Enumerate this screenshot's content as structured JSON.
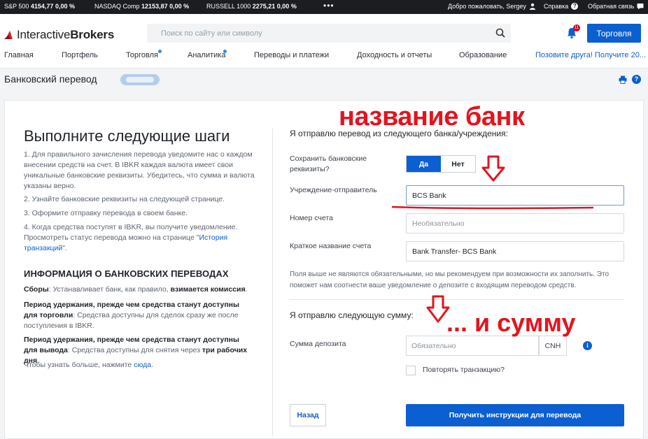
{
  "ticker": {
    "items": [
      {
        "name": "S&P 500",
        "value": "4154,77",
        "change": "0,00 %"
      },
      {
        "name": "NASDAQ Comp",
        "value": "12153,87",
        "change": "0,00 %"
      },
      {
        "name": "RUSSELL 1000",
        "value": "2275,21",
        "change": "0,00 %"
      }
    ],
    "more": "•••",
    "welcome": "Добро пожаловать, Sergey",
    "help": "Справка",
    "feedback": "Обратная связь"
  },
  "header": {
    "logo_light": "Interactive",
    "logo_bold": "Brokers",
    "search_placeholder": "Поиск по сайту или символу",
    "notification_count": "11",
    "trade_button": "Торговля"
  },
  "nav": {
    "items": [
      "Главная",
      "Портфель",
      "Торговля",
      "Аналитика",
      "Переводы и платежи",
      "Доходность и отчеты",
      "Образование"
    ],
    "invite": "Позовите друга! Получите 20..."
  },
  "page": {
    "title": "Банковский перевод"
  },
  "left": {
    "title": "Выполните следующие шаги",
    "step1": "1. Для правильного зачисления перевода уведомите нас о каждом внесении средств на счет. В IBKR каждая валюта имеет свои уникальные банковские реквизиты. Убедитесь, что сумма и валюта указаны верно.",
    "step2": "2. Узнайте банковские реквизиты на следующей странице.",
    "step3": "3. Оформите отправку перевода в своем банке.",
    "step4_text": "4. Когда средства поступят в IBKR, вы получите уведомление. Просмотреть статус перевода можно на странице \"",
    "step4_link": "История транзакций",
    "step4_end": "\".",
    "info_title": "ИНФОРМАЦИЯ О БАНКОВСКИХ ПЕРЕВОДАХ",
    "fees_label": "Сборы",
    "fees_text": ": Устанавливает банк, как правило, ",
    "fees_bold": "взимается комиссия",
    "fees_end": ".",
    "hold_trade_label": "Период удержания, прежде чем средства станут доступны для торговли",
    "hold_trade_text": ": Средства доступны для сделок сразу же после поступления в IBKR.",
    "hold_withdraw_label": "Период удержания, прежде чем средства станут доступны для вывода",
    "hold_withdraw_text": ": Средства доступны для снятия через ",
    "hold_withdraw_bold": "три рабочих дня",
    "hold_withdraw_end": ".",
    "more_text": "Чтобы узнать больше, нажмите ",
    "more_link": "сюда",
    "more_end": "."
  },
  "right": {
    "section1_title": "Я отправлю перевод из следующего банка/учреждения:",
    "save_label": "Сохранить банковские реквизиты?",
    "yes": "Да",
    "no": "Нет",
    "institution_label": "Учреждение-отправитель",
    "institution_value": "BCS Bank",
    "account_label": "Номер счета",
    "account_placeholder": "Необязательно",
    "short_name_label": "Краткое название счета",
    "short_name_value": "Bank Transfer- BCS Bank",
    "hint": "Поля выше не являются обязательными, но мы рекомендуем при возможности их заполнить. Это поможет нам соотнести ваше уведомление о депозите с входящим переводом средств.",
    "section2_title": "Я отправлю следующую сумму:",
    "amount_label": "Сумма депозита",
    "amount_placeholder": "Обязательно",
    "currency": "CNH",
    "repeat_label": "Повторять транзакцию?",
    "back_button": "Назад",
    "get_instructions_button": "Получить инструкции для перевода"
  },
  "annotations": {
    "bank_name": "название банк",
    "and_amount": "... и сумму",
    "color": "#e3141e"
  }
}
